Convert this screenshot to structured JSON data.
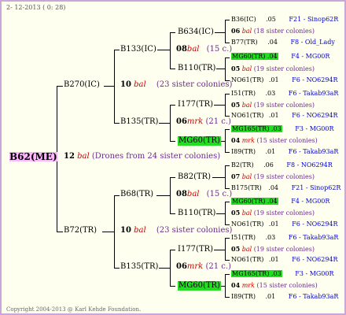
{
  "header": {
    "date": "2- 12-2013 (  0: 28)"
  },
  "footer": {
    "copyright": "Copyright 2004-2013 @ Karl Kehde Foundation."
  },
  "root": {
    "label": "B62(ME)",
    "num": "12",
    "q": "bal",
    "desc": "(Drones from 24 sister colonies)"
  },
  "l1": [
    {
      "label": "B270(IC)",
      "num": "10",
      "q": "bal",
      "desc": "(23 sister colonies)"
    },
    {
      "label": "B72(TR)",
      "num": "10",
      "q": "bal",
      "desc": "(23 sister colonies)"
    }
  ],
  "l2": [
    {
      "label": "B133(IC)",
      "num": "08",
      "q": "bal",
      "desc": "(15 c.)"
    },
    {
      "label": "B135(TR)",
      "num": "06",
      "q": "mrk",
      "desc": "(21 c.)"
    },
    {
      "label": "B68(TR)",
      "num": "08",
      "q": "bal",
      "desc": "(15 c.)"
    },
    {
      "label": "B135(TR)",
      "num": "06",
      "q": "mrk",
      "desc": "(21 c.)"
    }
  ],
  "l3": [
    {
      "label": "B634(IC)"
    },
    {
      "label": "B110(TR)"
    },
    {
      "label": "I177(TR)"
    },
    {
      "label": "MG60(TR)"
    },
    {
      "label": "B82(TR)"
    },
    {
      "label": "B110(TR)"
    },
    {
      "label": "I177(TR)"
    },
    {
      "label": "MG60(TR)"
    }
  ],
  "leaves": [
    {
      "name": "B36(IC)",
      "val": ".05",
      "code": "F21 - Sinop62R"
    },
    {
      "num": "06",
      "q": "bal",
      "desc": "(18 sister colonies)"
    },
    {
      "name": "B77(TR)",
      "val": ".04",
      "code": "F8 - Old_Lady"
    },
    {
      "name": "MG60(TR)",
      "val": ".04",
      "code": "F4 - MG00R"
    },
    {
      "num": "05",
      "q": "bal",
      "desc": "(19 sister colonies)"
    },
    {
      "name": "NO61(TR)",
      "val": ".01",
      "code": "F6 - NO6294R"
    },
    {
      "name": "I51(TR)",
      "val": ".03",
      "code": "F6 - Takab93aR"
    },
    {
      "num": "05",
      "q": "bal",
      "desc": "(19 sister colonies)"
    },
    {
      "name": "NO61(TR)",
      "val": ".01",
      "code": "F6 - NO6294R"
    },
    {
      "name": "MG165(TR)",
      "val": ".03",
      "code": "F3 - MG00R"
    },
    {
      "num": "04",
      "q": "mrk",
      "desc": "(15 sister colonies)"
    },
    {
      "name": "I89(TR)",
      "val": ".01",
      "code": "F6 - Takab93aR"
    },
    {
      "name": "B2(TR)",
      "val": ".06",
      "code": "F8 - NO6294R"
    },
    {
      "num": "07",
      "q": "bal",
      "desc": "(19 sister colonies)"
    },
    {
      "name": "B175(TR)",
      "val": ".04",
      "code": "F21 - Sinop62R"
    },
    {
      "name": "MG60(TR)",
      "val": ".04",
      "code": "F4 - MG00R"
    },
    {
      "num": "05",
      "q": "bal",
      "desc": "(19 sister colonies)"
    },
    {
      "name": "NO61(TR)",
      "val": ".01",
      "code": "F6 - NO6294R"
    },
    {
      "name": "I51(TR)",
      "val": ".03",
      "code": "F6 - Takab93aR"
    },
    {
      "num": "05",
      "q": "bal",
      "desc": "(19 sister colonies)"
    },
    {
      "name": "NO61(TR)",
      "val": ".01",
      "code": "F6 - NO6294R"
    },
    {
      "name": "MG165(TR)",
      "val": ".03",
      "code": "F3 - MG00R"
    },
    {
      "num": "04",
      "q": "mrk",
      "desc": "(15 sister colonies)"
    },
    {
      "name": "I89(TR)",
      "val": ".01",
      "code": "F6 - Takab93aR"
    }
  ],
  "colors": {
    "highlight_green": "#22dd22",
    "root_pink": "#ffb6ff",
    "queen_red": "#cc0000",
    "sister_purple": "#6a2a8f",
    "code_blue": "#0000cc"
  }
}
